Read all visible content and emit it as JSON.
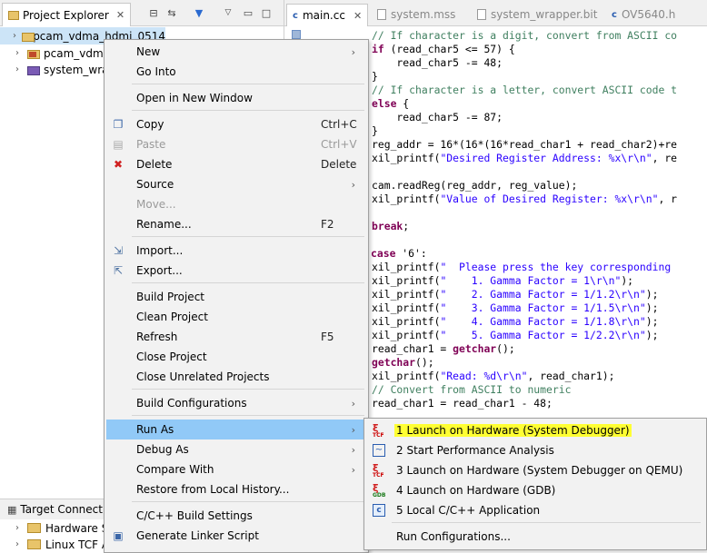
{
  "explorer": {
    "tab_label": "Project Explorer",
    "close_glyph": "✕",
    "toolbar_icons": [
      "collapse-all-icon",
      "link-editor-icon",
      "filter-icon",
      "view-menu-icon",
      "minimize-icon",
      "maximize-icon"
    ],
    "projects": [
      {
        "name": "pcam_vdma_hdmi_0514",
        "selected": true
      },
      {
        "name": "pcam_vdma"
      },
      {
        "name": "system_wrap"
      }
    ],
    "target_connections": {
      "label": "Target Connecti",
      "items": [
        "Hardware S",
        "Linux TCF A"
      ]
    }
  },
  "editor": {
    "tabs": [
      {
        "label": "main.cc",
        "active": true
      },
      {
        "label": "system.mss"
      },
      {
        "label": "system_wrapper.bit"
      },
      {
        "label": "OV5640.h"
      }
    ]
  },
  "context_menu": {
    "items": [
      {
        "label": "New",
        "submenu": true
      },
      {
        "label": "Go Into"
      },
      {
        "label": "Open in New Window"
      },
      {
        "label": "Copy",
        "shortcut": "Ctrl+C",
        "icon": "copy-icon"
      },
      {
        "label": "Paste",
        "shortcut": "Ctrl+V",
        "icon": "paste-icon",
        "disabled": true
      },
      {
        "label": "Delete",
        "shortcut": "Delete",
        "icon": "delete-icon"
      },
      {
        "label": "Source",
        "submenu": true
      },
      {
        "label": "Move...",
        "disabled": true
      },
      {
        "label": "Rename...",
        "shortcut": "F2"
      },
      {
        "label": "Import...",
        "icon": "import-icon"
      },
      {
        "label": "Export...",
        "icon": "export-icon"
      },
      {
        "label": "Build Project"
      },
      {
        "label": "Clean Project"
      },
      {
        "label": "Refresh",
        "shortcut": "F5"
      },
      {
        "label": "Close Project"
      },
      {
        "label": "Close Unrelated Projects"
      },
      {
        "label": "Build Configurations",
        "submenu": true
      },
      {
        "label": "Run As",
        "submenu": true,
        "highlighted": true
      },
      {
        "label": "Debug As",
        "submenu": true
      },
      {
        "label": "Compare With",
        "submenu": true
      },
      {
        "label": "Restore from Local History..."
      },
      {
        "label": "C/C++ Build Settings"
      },
      {
        "label": "Generate Linker Script",
        "icon": "linker-script-icon"
      }
    ]
  },
  "run_as_submenu": {
    "items": [
      {
        "label": "1 Launch on Hardware (System Debugger)",
        "icon": "tcf-icon",
        "highlighted": true
      },
      {
        "label": "2 Start Performance Analysis",
        "icon": "performance-icon"
      },
      {
        "label": "3 Launch on Hardware (System Debugger on QEMU)",
        "icon": "tcf-icon"
      },
      {
        "label": "4 Launch on Hardware (GDB)",
        "icon": "gdb-icon"
      },
      {
        "label": "5 Local C/C++ Application",
        "icon": "c-app-icon"
      },
      {
        "label": "Run Configurations..."
      }
    ]
  },
  "code": {
    "lines": [
      {
        "cls": "cm",
        "text": "// If character is a digit, convert from ASCII co"
      },
      {
        "parts": [
          {
            "cls": "kw",
            "text": "if"
          },
          {
            "text": " (read_char5 <= 57) {"
          }
        ]
      },
      {
        "text": "    read_char5 -= 48;"
      },
      {
        "text": "}"
      },
      {
        "cls": "cm",
        "text": "// If character is a letter, convert ASCII code t"
      },
      {
        "parts": [
          {
            "cls": "kw",
            "text": "else"
          },
          {
            "text": " {"
          }
        ]
      },
      {
        "text": "    read_char5 -= 87;"
      },
      {
        "text": "}"
      },
      {
        "text": "reg_addr = 16*(16*(16*read_char1 + read_char2)+re"
      },
      {
        "parts": [
          {
            "text": "xil_printf("
          },
          {
            "cls": "st",
            "text": "\"Desired Register Address: %x\\r\\n\""
          },
          {
            "text": ", re"
          }
        ]
      },
      {
        "text": ""
      },
      {
        "text": "cam.readReg(reg_addr, reg_value);"
      },
      {
        "parts": [
          {
            "text": "xil_printf("
          },
          {
            "cls": "st",
            "text": "\"Value of Desired Register: %x\\r\\n\""
          },
          {
            "text": ", r"
          }
        ]
      },
      {
        "text": ""
      },
      {
        "parts": [
          {
            "cls": "kw",
            "text": "break"
          },
          {
            "text": ";"
          }
        ]
      },
      {
        "text": ""
      },
      {
        "text": ""
      },
      {
        "parts": [
          {
            "text": "xil_printf("
          },
          {
            "cls": "st",
            "text": "\"  Please press the key corresponding"
          }
        ]
      },
      {
        "parts": [
          {
            "text": "xil_printf("
          },
          {
            "cls": "st",
            "text": "\"    1. Gamma Factor = 1\\r\\n\""
          },
          {
            "text": ");"
          }
        ]
      },
      {
        "parts": [
          {
            "text": "xil_printf("
          },
          {
            "cls": "st",
            "text": "\"    2. Gamma Factor = 1/1.2\\r\\n\""
          },
          {
            "text": ");"
          }
        ]
      },
      {
        "parts": [
          {
            "text": "xil_printf("
          },
          {
            "cls": "st",
            "text": "\"    3. Gamma Factor = 1/1.5\\r\\n\""
          },
          {
            "text": ");"
          }
        ]
      },
      {
        "parts": [
          {
            "text": "xil_printf("
          },
          {
            "cls": "st",
            "text": "\"    4. Gamma Factor = 1/1.8\\r\\n\""
          },
          {
            "text": ");"
          }
        ]
      },
      {
        "parts": [
          {
            "text": "xil_printf("
          },
          {
            "cls": "st",
            "text": "\"    5. Gamma Factor = 1/2.2\\r\\n\""
          },
          {
            "text": ");"
          }
        ]
      },
      {
        "parts": [
          {
            "text": "read_char1 = "
          },
          {
            "cls": "kw",
            "text": "getchar"
          },
          {
            "text": "();"
          }
        ]
      },
      {
        "parts": [
          {
            "cls": "kw",
            "text": "getchar"
          },
          {
            "text": "();"
          }
        ]
      },
      {
        "parts": [
          {
            "text": "xil_printf("
          },
          {
            "cls": "st",
            "text": "\"Read: %d\\r\\n\""
          },
          {
            "text": ", read_char1);"
          }
        ]
      },
      {
        "cls": "cm",
        "text": "// Convert from ASCII to numeric"
      },
      {
        "text": "read_char1 = read_char1 - 48;"
      }
    ],
    "case_line": {
      "kw": "case",
      "rest": " '6':"
    }
  }
}
